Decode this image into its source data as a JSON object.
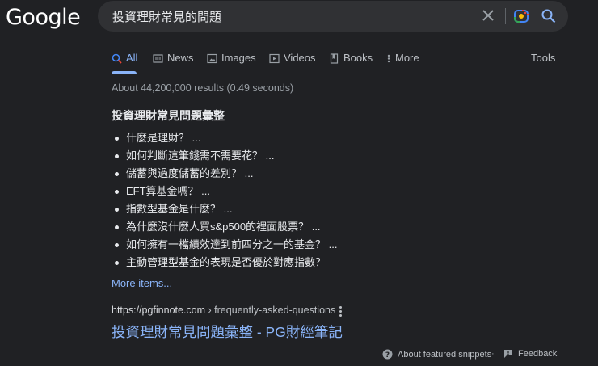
{
  "logo": "Google",
  "search": {
    "query": "投資理財常見的問題"
  },
  "tabs": [
    {
      "label": "All",
      "icon": "search-icon"
    },
    {
      "label": "News",
      "icon": "news-icon"
    },
    {
      "label": "Images",
      "icon": "image-icon"
    },
    {
      "label": "Videos",
      "icon": "video-icon"
    },
    {
      "label": "Books",
      "icon": "book-icon"
    },
    {
      "label": "More",
      "icon": "more-vert-icon"
    }
  ],
  "tools_label": "Tools",
  "stats": "About 44,200,000 results (0.49 seconds)",
  "featured_snippet": {
    "heading": "投資理財常見問題彙整",
    "items": [
      "什麼是理財？ ...",
      "如何判斷這筆錢需不需要花？ ...",
      "儲蓄與過度儲蓄的差別？ ...",
      "EFT算基金嗎？ ...",
      "指數型基金是什麼？ ...",
      "為什麼沒什麼人買s&p500的裡面股票？ ...",
      "如何擁有一檔績效達到前四分之一的基金？ ...",
      "主動管理型基金的表現是否優於對應指數？"
    ],
    "more_items": "More items..."
  },
  "result": {
    "url_domain": "https://pgfinnote.com",
    "url_path": " › frequently-asked-questions",
    "title": "投資理財常見問題彙整 - PG財經筆記"
  },
  "footer": {
    "about": "About featured snippets",
    "separator": "·",
    "feedback": "Feedback"
  },
  "colors": {
    "background": "#202124",
    "link": "#8ab4f8",
    "search_box": "#303134"
  }
}
